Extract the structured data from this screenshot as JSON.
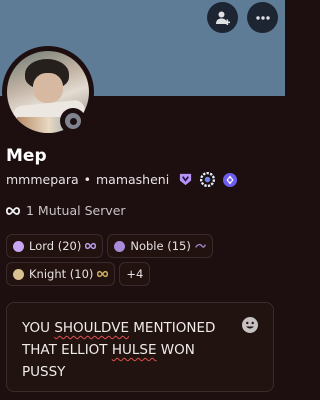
{
  "profile": {
    "display_name": "Mep",
    "username": "mmmepara",
    "pronouns_or_alt": "mamasheni",
    "separator": "•",
    "banner_color": "#5f7c97",
    "background_color": "#1d0e10",
    "status": "offline"
  },
  "badges": [
    "nitro-shield-icon",
    "hypesquad-ring-icon",
    "quest-badge-icon"
  ],
  "mutual": {
    "label": "1 Mutual Server",
    "icon": "infinity-icon"
  },
  "roles": [
    {
      "label": "Lord (20)",
      "dot_color": "#c9a6f3",
      "gem": "infinity-icon",
      "gem_color": "#b898e6"
    },
    {
      "label": "Noble (15)",
      "dot_color": "#a98ad8",
      "gem": "swirl-icon",
      "gem_color": "#9d86c9"
    },
    {
      "label": "Knight (10)",
      "dot_color": "#d9c290",
      "gem": "infinity-icon",
      "gem_color": "#c9aa62"
    },
    {
      "label": "+4"
    }
  ],
  "message": {
    "line1_a": "YOU ",
    "line1_b": "SHOULDVE",
    "line1_c": " MENTIONED",
    "line2_a": "THAT ELLIOT ",
    "line2_b": "HULSE",
    "line2_c": " WON",
    "line3": "PUSSY",
    "emoji_icon": "smiley-icon"
  }
}
